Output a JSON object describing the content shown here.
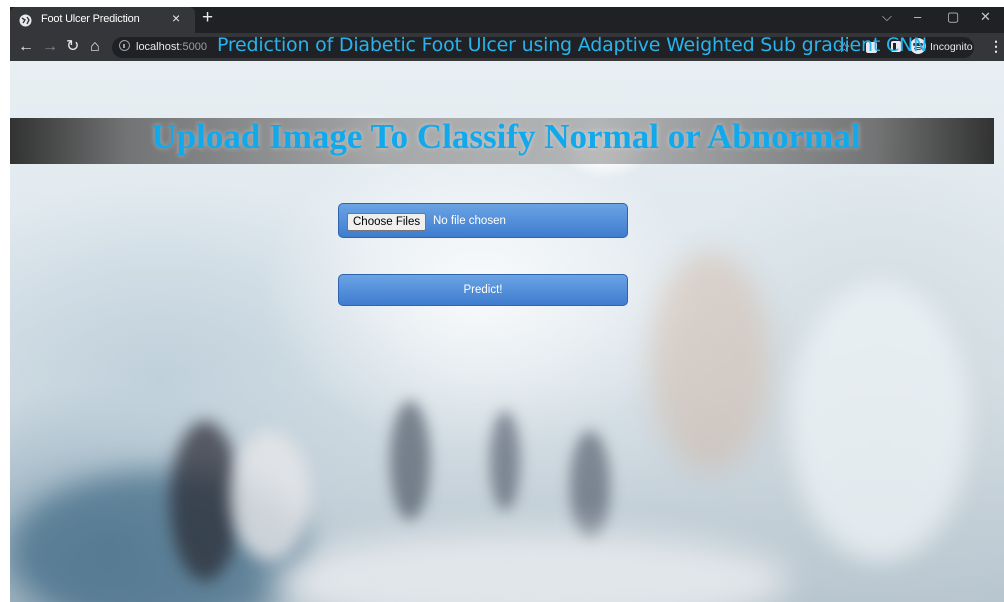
{
  "browser": {
    "tab_title": "Foot Ulcer Prediction",
    "tab_close": "×",
    "new_tab": "+",
    "url_host": "localhost",
    "url_port": ":5000",
    "incognito_label": "Incognito",
    "window_controls": {
      "minimize": "–",
      "maximize": "▢",
      "close": "✕",
      "dropdown": "⌵"
    },
    "nav": {
      "back": "←",
      "forward": "→",
      "reload": "↻",
      "home": "⌂"
    },
    "star": "☆",
    "menu": "⋮"
  },
  "page": {
    "title": "Prediction of Diabetic Foot Ulcer using Adaptive Weighted Sub gradient CNN",
    "banner": "Upload Image To Classify Normal or Abnormal",
    "file_button": "Choose Files",
    "file_status": "No file chosen",
    "predict_button": "Predict!"
  },
  "colors": {
    "title": "#26b3ee",
    "banner_text": "#11a9ec",
    "button": "#4a87d8"
  }
}
